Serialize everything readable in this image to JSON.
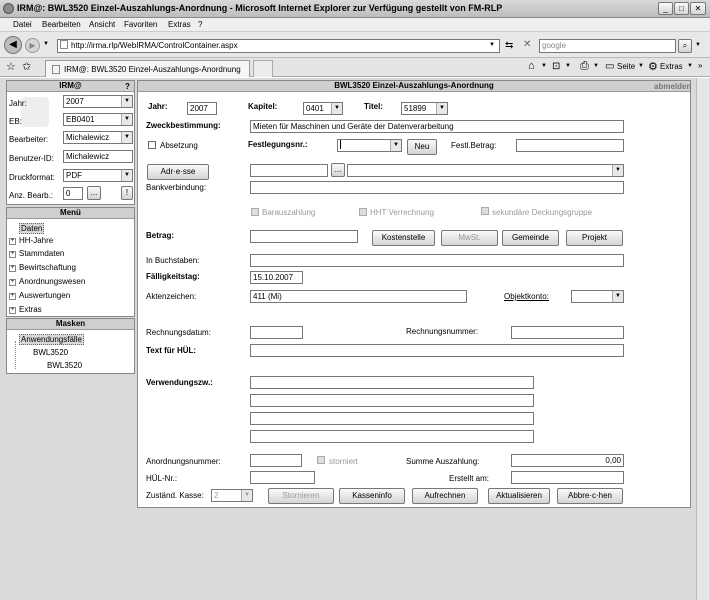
{
  "window": {
    "title": "IRM@: BWL3520 Einzel-Auszahlungs-Anordnung - Microsoft Internet Explorer  zur Verfügung gestellt von FM-RLP"
  },
  "menubar": {
    "items": [
      "Datei",
      "Bearbeiten",
      "Ansicht",
      "Favoriten",
      "Extras",
      "?"
    ]
  },
  "address": {
    "url": "http://irma.rlp/WebIRMA/ControlContainer.aspx",
    "search_placeholder": "google"
  },
  "tab": {
    "label": "IRM@: BWL3520 Einzel-Auszahlungs-Anordnung"
  },
  "toolbar": {
    "seite": "Seite",
    "extras": "Extras"
  },
  "left": {
    "header": "IRM@",
    "help": "?",
    "jahr_label": "Jahr:",
    "jahr_value": "2007",
    "eb_label": "EB:",
    "eb_value": "EB0401",
    "bearbeiter_label": "Bearbeiter:",
    "bearbeiter_value": "Michalewicz",
    "benutzer_label": "Benutzer-ID:",
    "benutzer_value": "Michalewicz",
    "druck_label": "Druckformat:",
    "druck_value": "PDF",
    "anz_label": "Anz. Bearb.:",
    "anz_value": "0",
    "anz_btn": "...",
    "anz_btn2": "!",
    "menu_header": "Menü",
    "menu_items": [
      "Daten",
      "HH-Jahre",
      "Stammdaten",
      "Bewirtschaftung",
      "Anordnungswesen",
      "Auswertungen",
      "Extras"
    ],
    "masken_header": "Masken",
    "masken_items": [
      "Anwendungsfälle",
      "BWL3520",
      "BWL3520"
    ]
  },
  "main": {
    "title": "BWL3520 Einzel-Auszahlungs-Anordnung",
    "abmelden": "abmelden",
    "jahr_label": "Jahr:",
    "jahr_value": "2007",
    "kapitel_label": "Kapitel:",
    "kapitel_value": "0401",
    "titel_label": "Titel:",
    "titel_value": "51899",
    "zweck_label": "Zweckbestimmung:",
    "zweck_value": "Mieten für Maschinen und Geräte der Datenverarbeitung",
    "absetzung": "Absetzung",
    "festlegung_label": "Festlegungsnr.:",
    "neu": "Neu",
    "festl_betrag_label": "Festl.Betrag:",
    "adresse_btn": "Adr·e·sse",
    "dots": "...",
    "bankverbindung": "Bankverbindung:",
    "barauszahlung": "Barauszahlung",
    "hht": "HHT Verrechnung",
    "sekundaer": "sekundäre Deckungsgruppe",
    "betrag_label": "Betrag:",
    "kostenstelle": "Kostenstelle",
    "mwst": "MwSt.",
    "gemeinde": "Gemeinde",
    "projekt": "Projekt",
    "buchstaben_label": "In Buchstaben:",
    "faellig_label": "Fälligkeitstag:",
    "faellig_value": "15.10.2007",
    "akten_label": "Aktenzeichen:",
    "akten_value": "411 (Mi)",
    "objekt_label": "Objektkonto:",
    "rdatum_label": "Rechnungsdatum:",
    "rnummer_label": "Rechnungsnummer:",
    "text_hul_label": "Text für HÜL:",
    "verwendung_label": "Verwendungszw.:",
    "anordnung_label": "Anordnungsnummer:",
    "storniert": "storniert",
    "summe_label": "Summe Auszahlung:",
    "summe_value": "0,00",
    "hul_label": "HÜL-Nr.:",
    "erstellt_label": "Erstellt am:",
    "kasse_label": "Zuständ. Kasse:",
    "kasse_value": "2",
    "stornieren": "Stornieren",
    "kasseninfo": "Kasseninfo",
    "aufrechnen": "Aufrechnen",
    "aktualisieren": "Aktualisieren",
    "abbrechen": "Abbre·c·hen"
  }
}
